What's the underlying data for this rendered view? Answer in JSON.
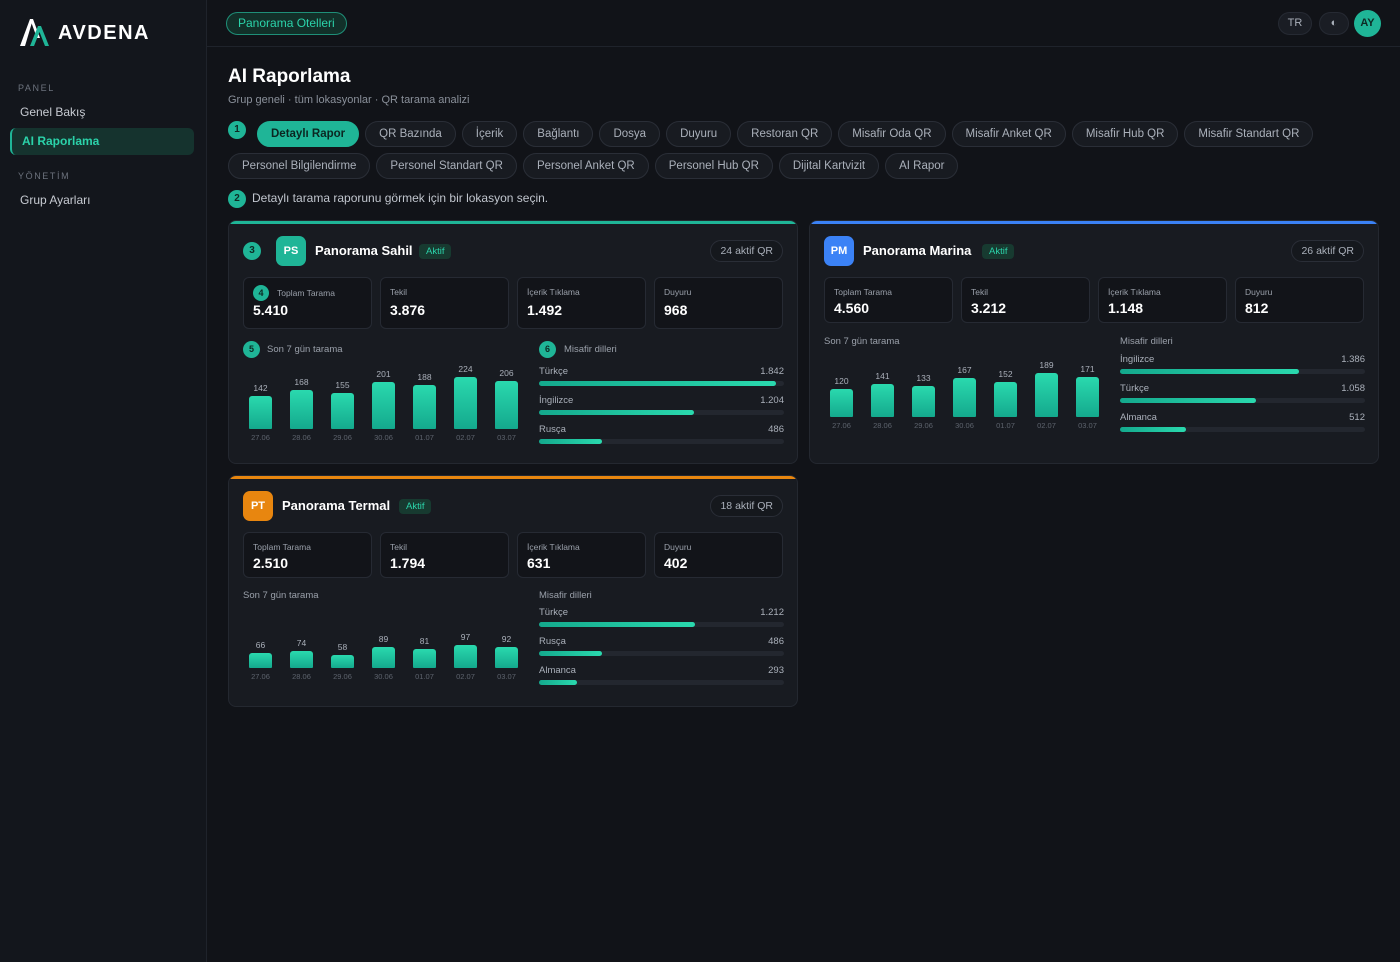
{
  "brand": {
    "name": "AVDENA"
  },
  "sidebar": {
    "section_panel": "PANEL",
    "section_management": "YÖNETİM",
    "items": [
      {
        "label": "Genel Bakış"
      },
      {
        "label": "AI Raporlama"
      },
      {
        "label": "Grup Ayarları"
      }
    ]
  },
  "topbar": {
    "hotel": "Panorama Otelleri",
    "lang": "TR",
    "theme_icon": "◐",
    "user_initials": "AY"
  },
  "page": {
    "title": "AI Raporlama",
    "subtitle": "Grup geneli · tüm lokasyonlar · QR tarama analizi",
    "hint": "Detaylı tarama raporunu görmek için bir lokasyon seçin."
  },
  "steps": [
    "1",
    "2",
    "3",
    "4",
    "5",
    "6"
  ],
  "tabs_row1": [
    "Detaylı Rapor",
    "QR Bazında",
    "İçerik",
    "Bağlantı",
    "Dosya",
    "Duyuru",
    "Restoran QR",
    "Misafir Oda QR",
    "Misafir Anket QR",
    "Misafir Hub QR",
    "Misafir Standart QR"
  ],
  "tabs_row2": [
    "Personel Bilgilendirme",
    "Personel Standart QR",
    "Personel Anket QR",
    "Personel Hub QR",
    "Dijital Kartvizit",
    "AI Rapor"
  ],
  "colors": {
    "accent": "#1fb597",
    "sahil": "#1fb597",
    "marina": "#3b82f6",
    "termal": "#e8860f"
  },
  "labels": {
    "status": "Aktif",
    "total": "Toplam Tarama",
    "unique": "Tekil",
    "content_click": "İçerik Tıklama",
    "announcement": "Duyuru",
    "last7": "Son 7 gün tarama",
    "languages": "Misafir dilleri"
  },
  "locations": [
    {
      "initials": "PS",
      "name": "Panorama Sahil",
      "qr": "24 aktif QR",
      "total": "5.410",
      "unique": "3.876",
      "clicks": "1.492",
      "announce": "968",
      "chart_data": {
        "type": "bar",
        "categories": [
          "27.06",
          "28.06",
          "29.06",
          "30.06",
          "01.07",
          "02.07",
          "03.07"
        ],
        "values": [
          142,
          168,
          155,
          201,
          188,
          224,
          206
        ]
      },
      "languages": [
        {
          "name": "Türkçe",
          "count": "1.842",
          "value": 1842
        },
        {
          "name": "İngilizce",
          "count": "1.204",
          "value": 1204
        },
        {
          "name": "Rusça",
          "count": "486",
          "value": 486
        }
      ]
    },
    {
      "initials": "PM",
      "name": "Panorama Marina",
      "qr": "26 aktif QR",
      "total": "4.560",
      "unique": "3.212",
      "clicks": "1.148",
      "announce": "812",
      "chart_data": {
        "type": "bar",
        "categories": [
          "27.06",
          "28.06",
          "29.06",
          "30.06",
          "01.07",
          "02.07",
          "03.07"
        ],
        "values": [
          120,
          141,
          133,
          167,
          152,
          189,
          171
        ]
      },
      "languages": [
        {
          "name": "İngilizce",
          "count": "1.386",
          "value": 1386
        },
        {
          "name": "Türkçe",
          "count": "1.058",
          "value": 1058
        },
        {
          "name": "Almanca",
          "count": "512",
          "value": 512
        }
      ]
    },
    {
      "initials": "PT",
      "name": "Panorama Termal",
      "qr": "18 aktif QR",
      "total": "2.510",
      "unique": "1.794",
      "clicks": "631",
      "announce": "402",
      "chart_data": {
        "type": "bar",
        "categories": [
          "27.06",
          "28.06",
          "29.06",
          "30.06",
          "01.07",
          "02.07",
          "03.07"
        ],
        "values": [
          66,
          74,
          58,
          89,
          81,
          97,
          92
        ]
      },
      "languages": [
        {
          "name": "Türkçe",
          "count": "1.212",
          "value": 1212
        },
        {
          "name": "Rusça",
          "count": "486",
          "value": 486
        },
        {
          "name": "Almanca",
          "count": "293",
          "value": 293
        }
      ]
    }
  ]
}
